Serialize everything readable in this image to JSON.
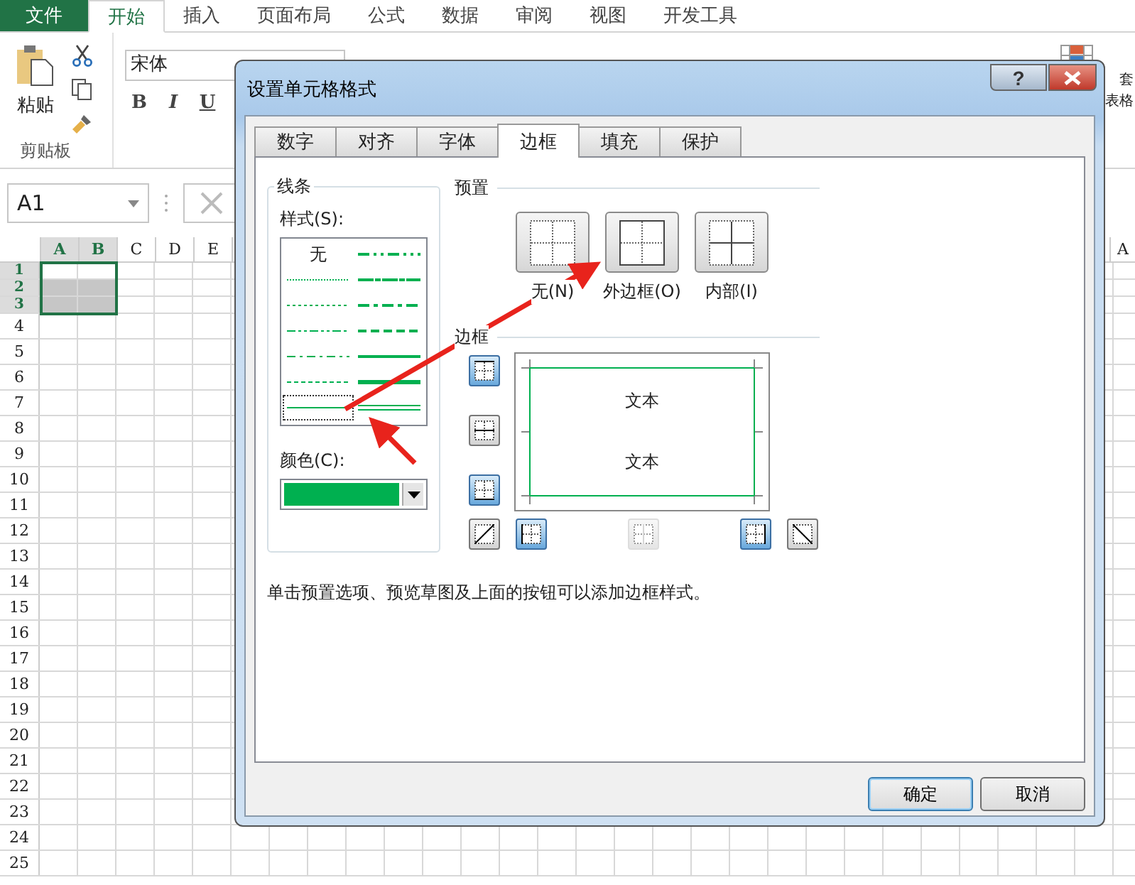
{
  "file_tab": {
    "label": "文件"
  },
  "ribbon_tabs": [
    {
      "label": "开始",
      "selected": true
    },
    {
      "label": "插入",
      "selected": false
    },
    {
      "label": "页面布局",
      "selected": false
    },
    {
      "label": "公式",
      "selected": false
    },
    {
      "label": "数据",
      "selected": false
    },
    {
      "label": "审阅",
      "selected": false
    },
    {
      "label": "视图",
      "selected": false
    },
    {
      "label": "开发工具",
      "selected": false
    }
  ],
  "ribbon": {
    "paste_label": "粘贴",
    "clipboard_label": "剪贴板",
    "font": "宋体",
    "format_buttons": [
      {
        "label": "B",
        "kind": "bold"
      },
      {
        "label": "I",
        "kind": "italic"
      },
      {
        "label": "U",
        "kind": "underline"
      }
    ],
    "right_labels": [
      "套",
      "表格"
    ]
  },
  "name_box": "A1",
  "sheet": {
    "columns": [
      {
        "label": "A",
        "selected": true
      },
      {
        "label": "B",
        "selected": true
      },
      {
        "label": "C",
        "selected": false
      },
      {
        "label": "D",
        "selected": false
      },
      {
        "label": "E",
        "selected": false
      }
    ],
    "right_column": "A",
    "rows": [
      {
        "label": "1",
        "selected": true
      },
      {
        "label": "2",
        "selected": true
      },
      {
        "label": "3",
        "selected": true
      },
      {
        "label": "4",
        "selected": false
      },
      {
        "label": "5",
        "selected": false
      },
      {
        "label": "6",
        "selected": false
      },
      {
        "label": "7",
        "selected": false
      },
      {
        "label": "8",
        "selected": false
      },
      {
        "label": "9",
        "selected": false
      },
      {
        "label": "10",
        "selected": false
      },
      {
        "label": "11",
        "selected": false
      },
      {
        "label": "12",
        "selected": false
      },
      {
        "label": "13",
        "selected": false
      },
      {
        "label": "14",
        "selected": false
      },
      {
        "label": "15",
        "selected": false
      },
      {
        "label": "16",
        "selected": false
      },
      {
        "label": "17",
        "selected": false
      },
      {
        "label": "18",
        "selected": false
      },
      {
        "label": "19",
        "selected": false
      },
      {
        "label": "20",
        "selected": false
      },
      {
        "label": "21",
        "selected": false
      },
      {
        "label": "22",
        "selected": false
      },
      {
        "label": "23",
        "selected": false
      },
      {
        "label": "24",
        "selected": false
      },
      {
        "label": "25",
        "selected": false
      }
    ]
  },
  "dialog": {
    "title": "设置单元格格式",
    "help": "?",
    "tabs": [
      {
        "label": "数字",
        "selected": false
      },
      {
        "label": "对齐",
        "selected": false
      },
      {
        "label": "字体",
        "selected": false
      },
      {
        "label": "边框",
        "selected": true
      },
      {
        "label": "填充",
        "selected": false
      },
      {
        "label": "保护",
        "selected": false
      }
    ],
    "line_group": {
      "title": "线条",
      "style_label": "样式(S):",
      "styles": [
        {
          "kind": "none",
          "label": "无",
          "selected": false
        },
        {
          "kind": "hair",
          "selected": false
        },
        {
          "kind": "dotted",
          "selected": false
        },
        {
          "kind": "dash-dot-dot",
          "selected": false
        },
        {
          "kind": "dash-dot",
          "selected": false
        },
        {
          "kind": "dashed",
          "selected": false
        },
        {
          "kind": "thin",
          "selected": true
        },
        {
          "kind": "medium-dash-dot-dot",
          "selected": false
        },
        {
          "kind": "slanted-dash-dot",
          "selected": false
        },
        {
          "kind": "medium-dash-dot",
          "selected": false
        },
        {
          "kind": "medium-dashed",
          "selected": false
        },
        {
          "kind": "medium",
          "selected": false
        },
        {
          "kind": "thick",
          "selected": false
        },
        {
          "kind": "double",
          "selected": false
        }
      ],
      "color_label": "颜色(C):",
      "color": "#00b050"
    },
    "presets_title": "预置",
    "presets": [
      {
        "kind": "none",
        "label": "无(N)"
      },
      {
        "kind": "outline",
        "label": "外边框(O)"
      },
      {
        "kind": "inside",
        "label": "内部(I)"
      }
    ],
    "border_title": "边框",
    "border_buttons": [
      {
        "kind": "top",
        "on": true,
        "disabled": false
      },
      {
        "kind": "middle-h",
        "on": false,
        "disabled": false
      },
      {
        "kind": "bottom",
        "on": true,
        "disabled": false
      },
      {
        "kind": "diag-up",
        "on": false,
        "disabled": false
      },
      {
        "kind": "left",
        "on": true,
        "disabled": false
      },
      {
        "kind": "middle-v",
        "on": false,
        "disabled": true
      },
      {
        "kind": "right",
        "on": true,
        "disabled": false
      },
      {
        "kind": "diag-down",
        "on": false,
        "disabled": false
      }
    ],
    "preview_text": [
      "文本",
      "文本"
    ],
    "hint": "单击预置选项、预览草图及上面的按钮可以添加边框样式。",
    "buttons": [
      {
        "label": "确定",
        "default": true
      },
      {
        "label": "取消",
        "default": false
      }
    ]
  }
}
